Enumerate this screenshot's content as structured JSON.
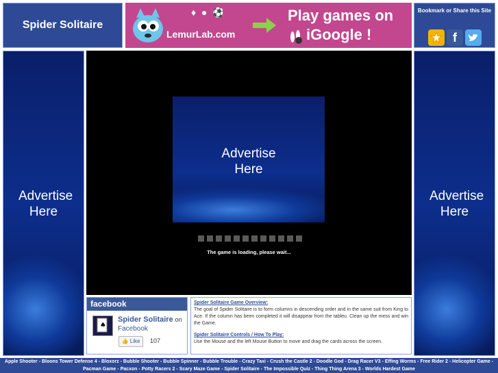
{
  "header": {
    "site_title": "Spider Solitaire",
    "banner": {
      "brand": "LemurLab.com",
      "headline_line1": "Play games on",
      "headline_line2": "iGoogle !"
    },
    "share": {
      "label": "Bookmark or Share this Site",
      "icons": [
        "star-icon",
        "facebook-icon",
        "twitter-icon"
      ]
    }
  },
  "ads": {
    "left": "Advertise Here",
    "center": "Advertise Here",
    "right": "Advertise Here"
  },
  "game": {
    "loading_blocks": 12,
    "loading_text": "The game is loading, please wait..."
  },
  "facebook": {
    "header": "facebook",
    "page_name": "Spider Solitaire",
    "on_label": "on",
    "platform": "Facebook",
    "like_label": "Like",
    "like_count": "107"
  },
  "description": {
    "overview_heading": "Spider Solitaire Game Overview:",
    "overview_text": "The goal of Spider Solitaire is to form columns in descending order and in the same suit from King to Ace. If the column has been completed it will disappear from the tableu. Clean up the mess and win the Game.",
    "controls_heading": "Spider Solitaire Controls / How To Play:",
    "controls_text": "Use the Mouse and the left Mouse Button to move and drag the cards across the screen."
  },
  "footer": {
    "games": [
      "Apple Shooter",
      "Bloons Tower Defense 4",
      "Bloxorz",
      "Bubble Shooter",
      "Bubble Spinner",
      "Bubble Trouble",
      "Crazy Taxi",
      "Crush the Castle 2",
      "Doodle God",
      "Drag Racer V3",
      "Effing Worms",
      "Free Rider 2",
      "Helicopter Game",
      "Pacman Game",
      "Pacxon",
      "Potty Racers 2",
      "Scary Maze Game",
      "Spider Solitaire",
      "The Impossible Quiz",
      "Thing Thing Arena 3",
      "Worlds Hardest Game"
    ]
  },
  "colors": {
    "header_blue": "#2e4a96",
    "banner_pink": "#c2478f",
    "facebook_blue": "#3b5998",
    "game_bg": "#000000"
  }
}
